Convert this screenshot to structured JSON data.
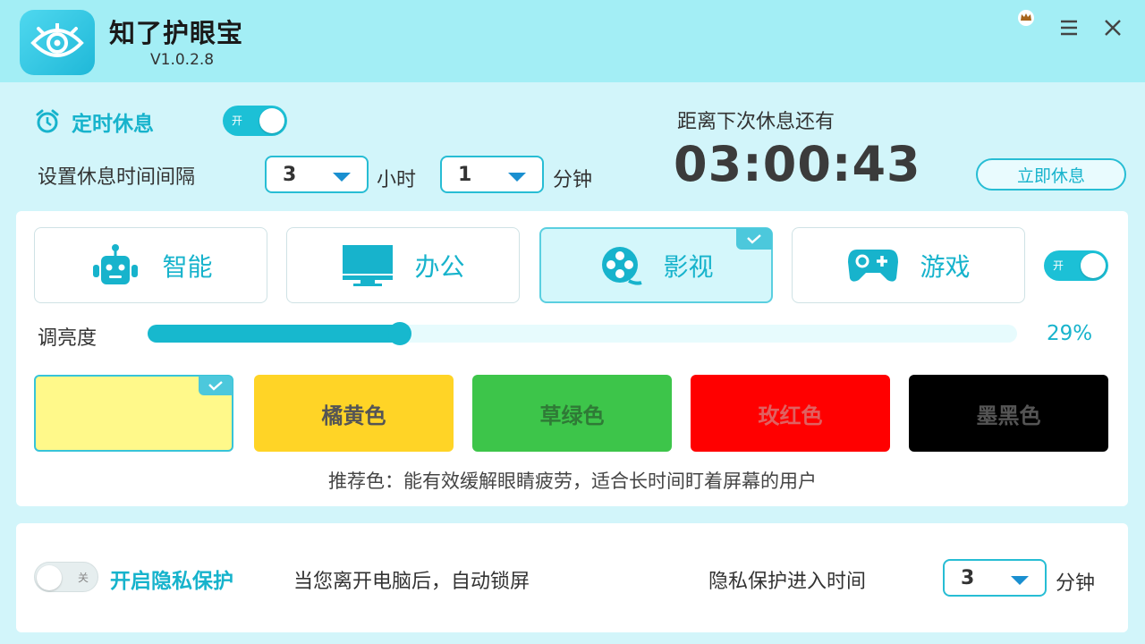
{
  "app": {
    "title": "知了护眼宝",
    "version": "V1.0.2.8"
  },
  "timer": {
    "title": "定时休息",
    "toggle_label": "开",
    "interval_label": "设置休息时间间隔",
    "hours_value": "3",
    "hours_unit": "小时",
    "minutes_value": "1",
    "minutes_unit": "分钟",
    "countdown_label": "距离下次休息还有",
    "countdown": "03:00:43",
    "rest_now_label": "立即休息"
  },
  "modes": {
    "items": [
      {
        "label": "智能",
        "icon": "robot-icon"
      },
      {
        "label": "办公",
        "icon": "monitor-icon"
      },
      {
        "label": "影视",
        "icon": "film-reel-icon",
        "selected": true
      },
      {
        "label": "游戏",
        "icon": "gamepad-icon"
      }
    ],
    "toggle_label": "开"
  },
  "brightness": {
    "label": "调亮度",
    "value_text": "29%",
    "fraction": 0.29
  },
  "colors": {
    "items": [
      {
        "label": "",
        "color": "#fff98a",
        "selected": true
      },
      {
        "label": "橘黄色",
        "color": "#ffd426",
        "text_color": "#555555"
      },
      {
        "label": "草绿色",
        "color": "#3dc54a",
        "text_color": "#2f7a36"
      },
      {
        "label": "玫红色",
        "color": "#ff0000",
        "text_color": "#e06060"
      },
      {
        "label": "墨黑色",
        "color": "#000000",
        "text_color": "#555555"
      }
    ],
    "recommendation": "推荐色：能有效缓解眼睛疲劳，适合长时间盯着屏幕的用户"
  },
  "privacy": {
    "toggle_label": "关",
    "title": "开启隐私保护",
    "description": "当您离开电脑后，自动锁屏",
    "time_label": "隐私保护进入时间",
    "time_value": "3",
    "time_unit": "分钟"
  },
  "accent_color": "#17b3cc"
}
